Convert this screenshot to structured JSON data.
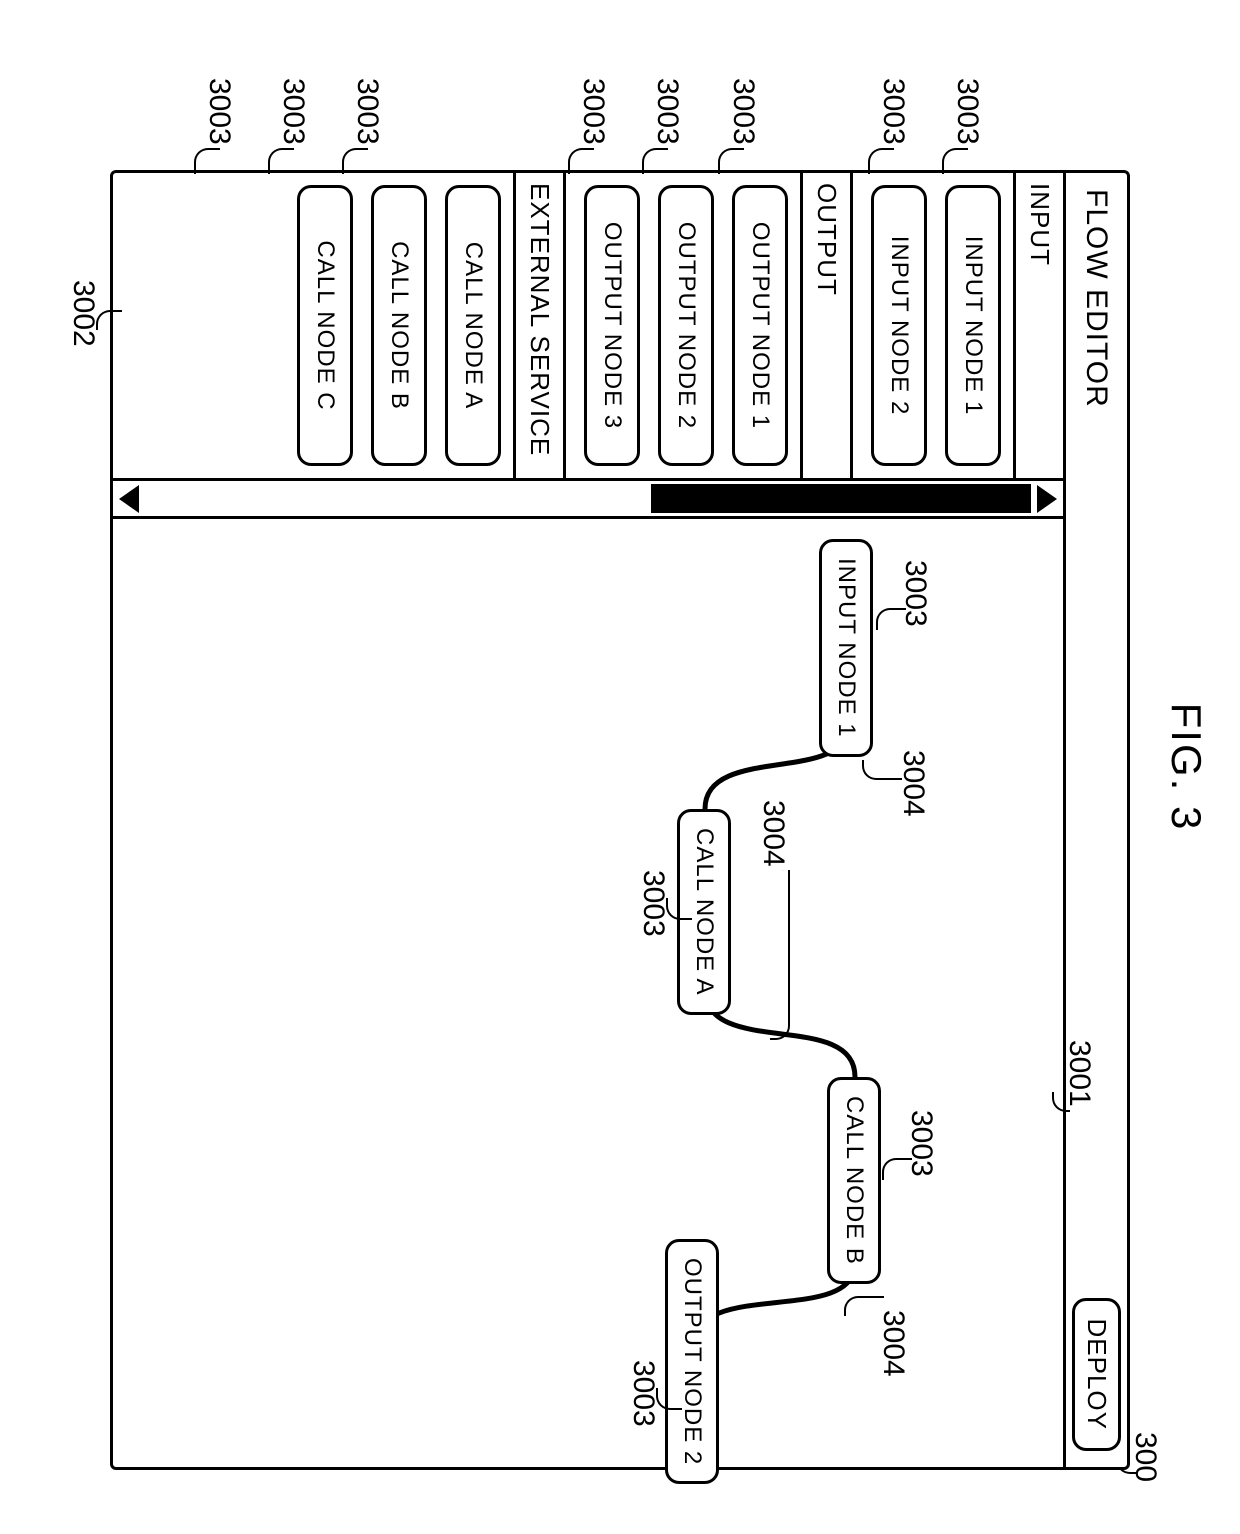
{
  "figure": {
    "title": "FIG. 3"
  },
  "window": {
    "title": "FLOW EDITOR",
    "ref": "300"
  },
  "deploy": {
    "label": "DEPLOY"
  },
  "canvas_ref": "3001",
  "palette_ref": "3002",
  "node_ref": "3003",
  "wire_ref": "3004",
  "palette": {
    "sections": [
      {
        "title": "INPUT",
        "items": [
          "INPUT NODE 1",
          "INPUT NODE 2"
        ]
      },
      {
        "title": "OUTPUT",
        "items": [
          "OUTPUT NODE 1",
          "OUTPUT NODE 2",
          "OUTPUT NODE 3"
        ]
      },
      {
        "title": "EXTERNAL SERVICE",
        "items": [
          "CALL NODE A",
          "CALL NODE B",
          "CALL NODE C"
        ]
      }
    ]
  },
  "canvas_nodes": {
    "in1": "INPUT NODE 1",
    "callA": "CALL NODE A",
    "callB": "CALL NODE B",
    "out2": "OUTPUT NODE 2"
  }
}
